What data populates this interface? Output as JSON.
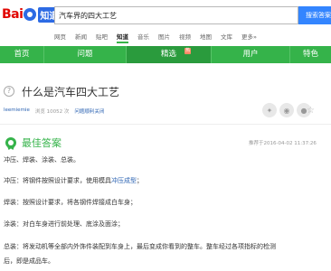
{
  "header": {
    "logo_bai": "Bai",
    "logo_zhidao": "知道",
    "search_value": "汽车界的四大工艺",
    "search_button": "搜索答案"
  },
  "catnav": [
    "网页",
    "新闻",
    "贴吧",
    "知道",
    "音乐",
    "图片",
    "视频",
    "地图",
    "文库",
    "更多»"
  ],
  "catnav_active": "知道",
  "greenbar": {
    "items": [
      "首页",
      "问题",
      "精选",
      "用户",
      "特色"
    ],
    "hot_badge": "热"
  },
  "question": {
    "title": "什么是汽车四大工艺",
    "user": "leemiemie",
    "views": "浏览 10052 次",
    "similar": "问题顺利关闭"
  },
  "best_answer": {
    "title": "最佳答案",
    "time": "推荐于2016-04-02 11:37:26",
    "paragraphs": {
      "p1": "冲压、焊装、涂装、总装。",
      "p2_before": "冲压：将钢件按照设计要求，使用模具",
      "p2_link": "冲压成型",
      "p2_after": "；",
      "p3": "焊装：按照设计要求，将各钢件焊接成白车身；",
      "p4": "涂装：对白车身进行前处理、底涂及面涂；",
      "p5_line1": "总装：将发动机等全部内外饰件装配到车身上，最后变成你看到的整车。整车经过各项指标的检测",
      "p5_line2": "后，即是成品车。"
    }
  },
  "colors": {
    "green": "#35b34a",
    "blue_button": "#3385ff",
    "link": "#2d64b3"
  }
}
